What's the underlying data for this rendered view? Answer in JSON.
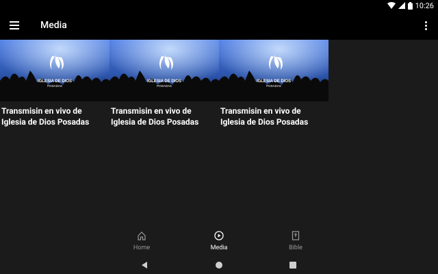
{
  "status": {
    "time": "10:26"
  },
  "app_bar": {
    "title": "Media"
  },
  "cards": [
    {
      "title": "Transmisin en vivo de Iglesia de Dios Posadas",
      "logo_line1": "IGLESIA DE DIOS",
      "logo_line2": "POSADAS"
    },
    {
      "title": "Transmisin en vivo de Iglesia de Dios Posadas",
      "logo_line1": "IGLESIA DE DIOS",
      "logo_line2": "POSADAS"
    },
    {
      "title": "Transmisin en vivo de Iglesia de Dios Posadas",
      "logo_line1": "IGLESIA DE DIOS",
      "logo_line2": "POSADAS"
    }
  ],
  "bottom_nav": [
    {
      "label": "Home",
      "icon": "home-icon"
    },
    {
      "label": "Media",
      "icon": "play-circle-icon"
    },
    {
      "label": "Bible",
      "icon": "bible-icon"
    }
  ],
  "colors": {
    "background": "#1b1b1b",
    "bars": "#000000",
    "inactive": "#9a9a9a"
  }
}
